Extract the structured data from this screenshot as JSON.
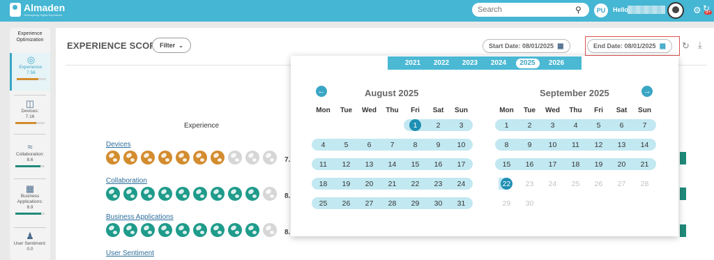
{
  "app": {
    "name": "Almaden",
    "tagline": "Reimagining Digital Experience"
  },
  "topbar": {
    "search_placeholder": "Search",
    "avatar_initials": "PU",
    "greeting": "Hello,",
    "notification_count": "9+"
  },
  "sidebar": {
    "header": "Experience Optimization",
    "items": [
      {
        "name": "Experience:",
        "value": "7.56",
        "progress": 0.76,
        "color": "#d38c2e"
      },
      {
        "name": "Devices:",
        "value": "7.16",
        "progress": 0.72,
        "color": "#d38c2e"
      },
      {
        "name": "Collaboration:",
        "value": "8.6",
        "progress": 0.86,
        "color": "#1f8a7a"
      },
      {
        "name": "Business Applications:",
        "value": "8.9",
        "progress": 0.89,
        "color": "#1f8a7a"
      },
      {
        "name": "User Sentiment:",
        "value": "0.0",
        "progress": 0,
        "color": "#1f8a7a"
      }
    ]
  },
  "main": {
    "title": "EXPERIENCE SCORE",
    "filter_label": "Filter",
    "start_date": "Start Date: 08/01/2025",
    "end_date": "End Date: 08/01/2025",
    "experience_label": "Experience",
    "metrics": [
      {
        "label": "Devices",
        "score": "7.",
        "filled": 7,
        "color": "#d38c2e"
      },
      {
        "label": "Collaboration",
        "score": "8.",
        "filled": 9,
        "color": "#1f9b8b"
      },
      {
        "label": "Business Applications",
        "score": "8.",
        "filled": 9,
        "color": "#1f9b8b"
      },
      {
        "label": "User Sentiment",
        "score": "",
        "filled": 0,
        "color": "#1f9b8b"
      }
    ]
  },
  "calendar": {
    "years": [
      "2021",
      "2022",
      "2023",
      "2024",
      "2025",
      "2026"
    ],
    "selected_year": "2025",
    "weekdays": [
      "Mon",
      "Tue",
      "Wed",
      "Thu",
      "Fri",
      "Sat",
      "Sun"
    ],
    "months": [
      {
        "title": "August 2025",
        "weeks": [
          [
            "",
            "",
            "",
            "",
            "1",
            "2",
            "3"
          ],
          [
            "4",
            "5",
            "6",
            "7",
            "8",
            "9",
            "10"
          ],
          [
            "11",
            "12",
            "13",
            "14",
            "15",
            "16",
            "17"
          ],
          [
            "18",
            "19",
            "20",
            "21",
            "22",
            "23",
            "24"
          ],
          [
            "25",
            "26",
            "27",
            "28",
            "29",
            "30",
            "31"
          ]
        ],
        "selected_day": "1",
        "highlight_through_week": 4
      },
      {
        "title": "September 2025",
        "weeks": [
          [
            "1",
            "2",
            "3",
            "4",
            "5",
            "6",
            "7"
          ],
          [
            "8",
            "9",
            "10",
            "11",
            "12",
            "13",
            "14"
          ],
          [
            "15",
            "16",
            "17",
            "18",
            "19",
            "20",
            "21"
          ],
          [
            "22",
            "23",
            "24",
            "25",
            "26",
            "27",
            "28"
          ],
          [
            "29",
            "30",
            "",
            "",
            "",
            "",
            ""
          ]
        ],
        "today_day": "22",
        "highlight_through_week": 2
      }
    ]
  }
}
